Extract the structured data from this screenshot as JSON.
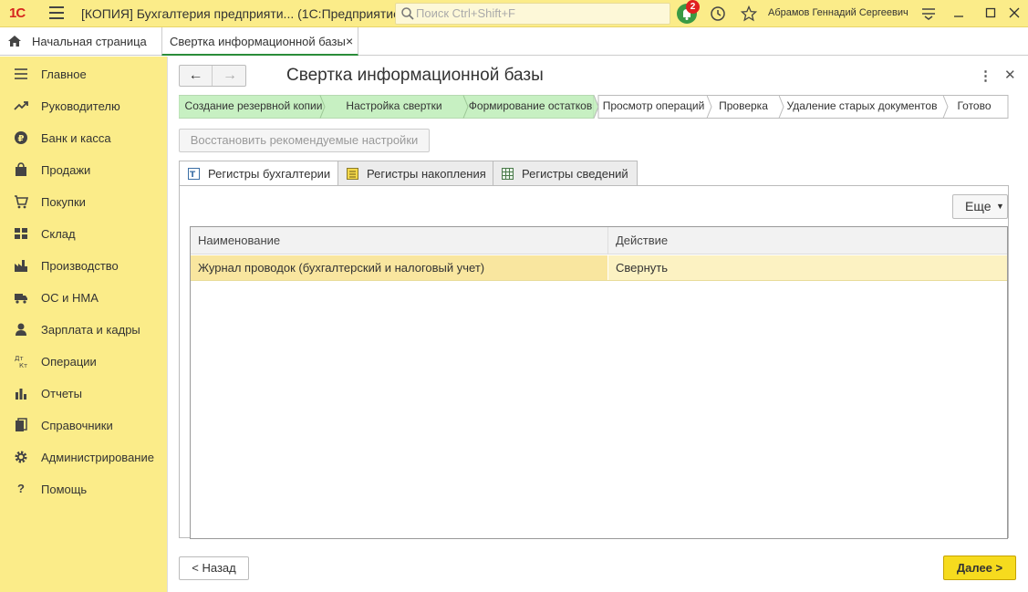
{
  "app": {
    "logo": "1С",
    "title": "[КОПИЯ] Бухгалтерия предприяти... (1С:Предприятие)",
    "search_placeholder": "Поиск Ctrl+Shift+F",
    "notifications_count": "2",
    "user_name": "Абрамов Геннадий Сергеевич"
  },
  "tabs": {
    "home_label": "Начальная страница",
    "active_label": "Свертка информационной базы",
    "close_glyph": "×"
  },
  "sidebar": {
    "items": [
      {
        "label": "Главное",
        "icon": "menu-icon"
      },
      {
        "label": "Руководителю",
        "icon": "trend-icon"
      },
      {
        "label": "Банк и касса",
        "icon": "coin-icon"
      },
      {
        "label": "Продажи",
        "icon": "bag-icon"
      },
      {
        "label": "Покупки",
        "icon": "cart-icon"
      },
      {
        "label": "Склад",
        "icon": "warehouse-icon"
      },
      {
        "label": "Производство",
        "icon": "factory-icon"
      },
      {
        "label": "ОС и НМА",
        "icon": "truck-icon"
      },
      {
        "label": "Зарплата и кадры",
        "icon": "person-icon"
      },
      {
        "label": "Операции",
        "icon": "dt-kt-icon"
      },
      {
        "label": "Отчеты",
        "icon": "bar-chart-icon"
      },
      {
        "label": "Справочники",
        "icon": "book-icon"
      },
      {
        "label": "Администрирование",
        "icon": "gear-icon"
      },
      {
        "label": "Помощь",
        "icon": "question-icon"
      }
    ]
  },
  "form": {
    "title": "Свертка информационной базы",
    "steps": [
      {
        "label": "Создание резервной копии",
        "status": "done"
      },
      {
        "label": "Настройка свертки",
        "status": "done"
      },
      {
        "label": "Формирование остатков",
        "status": "done"
      },
      {
        "label": "Просмотр операций",
        "status": "todo"
      },
      {
        "label": "Проверка",
        "status": "todo"
      },
      {
        "label": "Удаление старых документов",
        "status": "todo"
      },
      {
        "label": "Готово",
        "status": "todo"
      }
    ],
    "restore_button": "Восстановить рекомендуемые настройки",
    "register_tabs": [
      {
        "label": "Регистры бухгалтерии",
        "icon": "accounting-register-icon"
      },
      {
        "label": "Регистры накопления",
        "icon": "accumulation-register-icon"
      },
      {
        "label": "Регистры сведений",
        "icon": "info-register-icon"
      }
    ],
    "more_button": "Еще",
    "table": {
      "columns": [
        "Наименование",
        "Действие"
      ],
      "rows": [
        [
          "Журнал проводок (бухгалтерский и налоговый учет)",
          "Свернуть"
        ]
      ]
    },
    "back_button": "< Назад",
    "next_button": "Далее >"
  },
  "colors": {
    "chrome_yellow": "#fbec89",
    "step_done": "#c7f0c2",
    "selected_row": "#fcf2c2",
    "primary_button": "#f6db1e",
    "active_tab_underline": "#2a8c3a"
  }
}
